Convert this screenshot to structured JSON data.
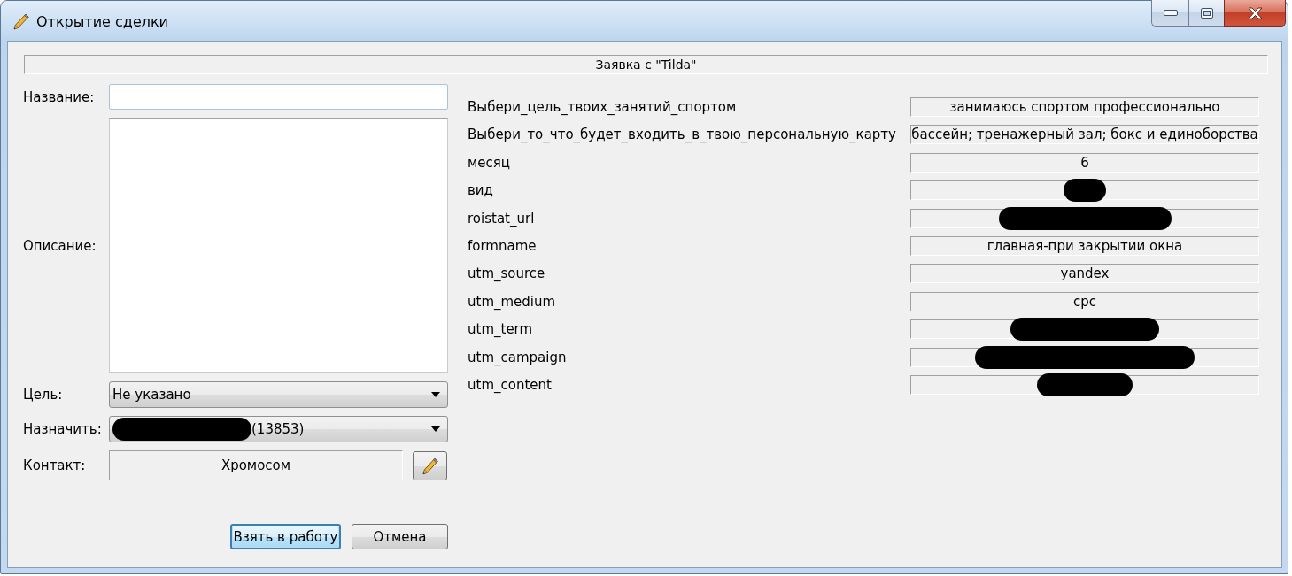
{
  "window": {
    "title": "Открытие сделки"
  },
  "source_header": "Заявка с \"Tilda\"",
  "form": {
    "fields": [
      {
        "kind": "input",
        "label": "Название:",
        "redacted": false
      },
      {
        "kind": "textarea",
        "label": "Описание:",
        "redacted": false
      },
      {
        "kind": "dropdown",
        "label": "Цель:",
        "value": "Не указано",
        "redacted": false
      },
      {
        "kind": "dropdown",
        "label": "Назначить:",
        "value": "(13853)",
        "redacted": true
      },
      {
        "kind": "readonly",
        "label": "Контакт:",
        "value": "Хромосом",
        "redacted": false
      }
    ]
  },
  "buttons": [
    {
      "label": "Взять в работу",
      "focused": true
    },
    {
      "label": "Отмена",
      "focused": false
    }
  ],
  "properties": [
    {
      "name": "Выбери_цель_твоих_занятий_спортом",
      "value": "занимаюсь спортом профессионально",
      "redacted": false
    },
    {
      "name": "Выбери_то_что_будет_входить_в_твою_персональную_карту",
      "value": "бассейн; тренажерный зал; бокс и единоборства",
      "redacted": false
    },
    {
      "name": "месяц",
      "value": "6",
      "redacted": false
    },
    {
      "name": "вид",
      "redacted": true
    },
    {
      "name": "roistat_url",
      "redacted": true
    },
    {
      "name": "formname",
      "value": "главная-при закрытии окна",
      "redacted": false
    },
    {
      "name": "utm_source",
      "value": "yandex",
      "redacted": false
    },
    {
      "name": "utm_medium",
      "value": "cpc",
      "redacted": false
    },
    {
      "name": "utm_term",
      "redacted": true
    },
    {
      "name": "utm_campaign",
      "redacted": true
    },
    {
      "name": "utm_content",
      "redacted": true
    }
  ]
}
